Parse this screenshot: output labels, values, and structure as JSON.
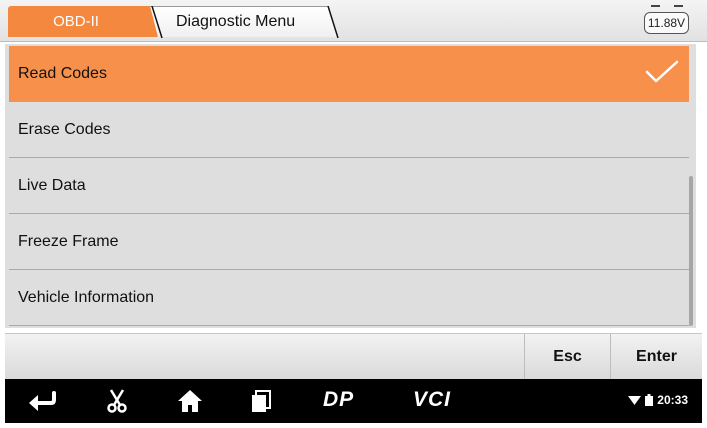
{
  "header": {
    "breadcrumb_root": "OBD-II",
    "breadcrumb_current": "Diagnostic Menu",
    "battery_voltage": "11.88V"
  },
  "menu": {
    "items": [
      {
        "label": "Read Codes",
        "selected": true
      },
      {
        "label": "Erase Codes",
        "selected": false
      },
      {
        "label": "Live Data",
        "selected": false
      },
      {
        "label": "Freeze Frame",
        "selected": false
      },
      {
        "label": "Vehicle Information",
        "selected": false
      }
    ]
  },
  "actions": {
    "esc_label": "Esc",
    "enter_label": "Enter"
  },
  "navbar": {
    "icons": [
      "back-icon",
      "screenshot-scissors-icon",
      "home-icon",
      "recent-apps-icon",
      "dp-icon",
      "vci-icon"
    ],
    "dp_label": "DP",
    "vci_label": "VCI",
    "clock": "20:33"
  },
  "colors": {
    "accent": "#f5883f",
    "selected_row": "#f7904a",
    "list_bg": "#dedede",
    "navbar_bg": "#000000"
  }
}
